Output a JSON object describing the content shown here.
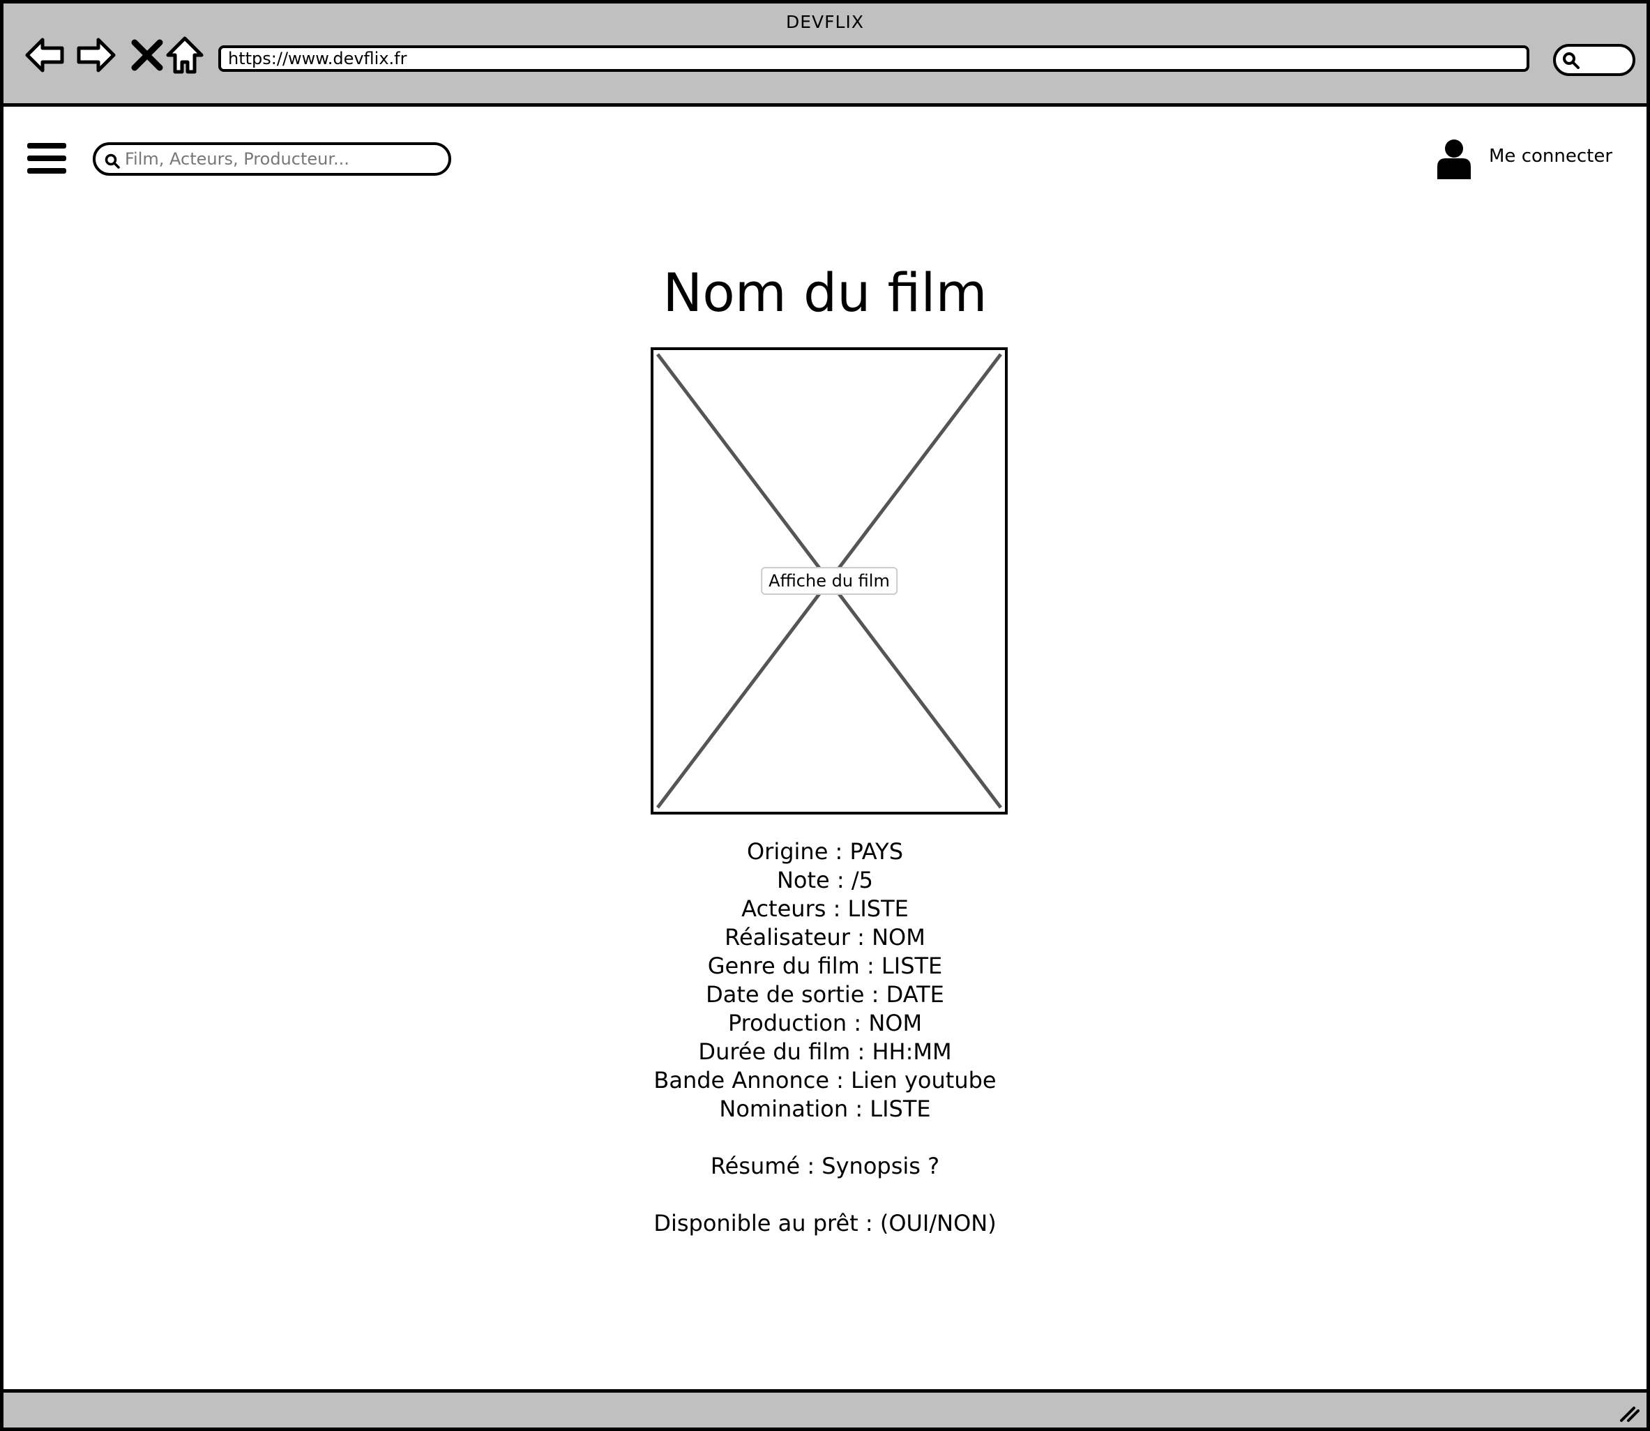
{
  "window": {
    "title": "DEVFLIX"
  },
  "browser": {
    "url": "https://www.devflix.fr",
    "icons": [
      "back-arrow-icon",
      "forward-arrow-icon",
      "close-icon",
      "home-icon",
      "search-icon"
    ]
  },
  "header": {
    "search_placeholder": "Film, Acteurs, Producteur...",
    "login_label": "Me connecter"
  },
  "movie": {
    "title": "Nom du film",
    "poster_label": "Affiche du film",
    "details": [
      "Origine : PAYS",
      "Note :  /5",
      "Acteurs : LISTE",
      "Réalisateur : NOM",
      "Genre du film : LISTE",
      "Date de sortie : DATE",
      "Production : NOM",
      "Durée du film : HH:MM",
      "Bande Annonce : Lien youtube",
      "Nomination : LISTE"
    ],
    "summary": "Résumé : Synopsis ?",
    "availability": "Disponible au prêt : (OUI/NON)"
  },
  "colors": {
    "chrome": "#c0c0c0",
    "border": "#000000",
    "placeholder_x": "#555555"
  }
}
